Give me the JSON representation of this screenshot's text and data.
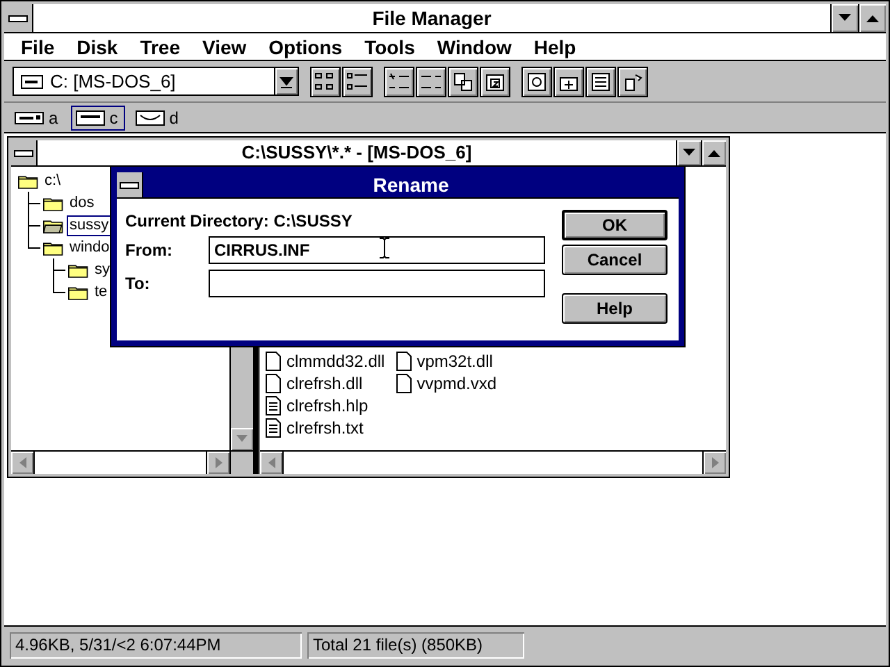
{
  "window": {
    "title": "File Manager"
  },
  "menu": [
    {
      "label": "File"
    },
    {
      "label": "Disk"
    },
    {
      "label": "Tree"
    },
    {
      "label": "View"
    },
    {
      "label": "Options"
    },
    {
      "label": "Tools"
    },
    {
      "label": "Window"
    },
    {
      "label": "Help"
    }
  ],
  "drive_combo": {
    "value": "C: [MS-DOS_6]"
  },
  "toolbar": [
    {
      "kind": "large-icons"
    },
    {
      "kind": "details"
    },
    {
      "kind": "sort-name"
    },
    {
      "kind": "sort-type"
    },
    {
      "kind": "copy"
    },
    {
      "kind": "archive"
    },
    {
      "kind": "disk"
    },
    {
      "kind": "add"
    },
    {
      "kind": "list"
    },
    {
      "kind": "tools"
    }
  ],
  "drives": [
    {
      "letter": "a",
      "kind": "floppy",
      "selected": false
    },
    {
      "letter": "c",
      "kind": "hard",
      "selected": true
    },
    {
      "letter": "d",
      "kind": "cdrom",
      "selected": false
    }
  ],
  "child_window": {
    "title": "C:\\SUSSY\\*.* - [MS-DOS_6]"
  },
  "tree": [
    {
      "name": "c:\\",
      "selected": false,
      "children": [
        {
          "name": "dos",
          "selected": false
        },
        {
          "name": "sussy",
          "selected": true
        },
        {
          "name": "windo",
          "selected": false,
          "children": [
            {
              "name": "sy",
              "selected": false
            },
            {
              "name": "te",
              "selected": false
            }
          ]
        }
      ]
    }
  ],
  "files": [
    {
      "name": "clmmdd32.dll",
      "kind": "file"
    },
    {
      "name": "clrefrsh.dll",
      "kind": "file"
    },
    {
      "name": "clrefrsh.hlp",
      "kind": "document"
    },
    {
      "name": "clrefrsh.txt",
      "kind": "document"
    },
    {
      "name": "vpm32t.dll",
      "kind": "file"
    },
    {
      "name": "vvpmd.vxd",
      "kind": "file"
    }
  ],
  "dialog": {
    "title": "Rename",
    "current_directory": "Current Directory: C:\\SUSSY",
    "fields": [
      {
        "label": "From:",
        "value": "CIRRUS.INF"
      },
      {
        "label": "To:"
      }
    ],
    "buttons": [
      {
        "label": "OK",
        "default": true
      },
      {
        "label": "Cancel",
        "default": false
      },
      {
        "label": "Help",
        "default": false
      }
    ]
  },
  "status_bar": [
    "4.96KB, 5/31/<2 6:07:44PM",
    "Total 21 file(s) (850KB)"
  ]
}
